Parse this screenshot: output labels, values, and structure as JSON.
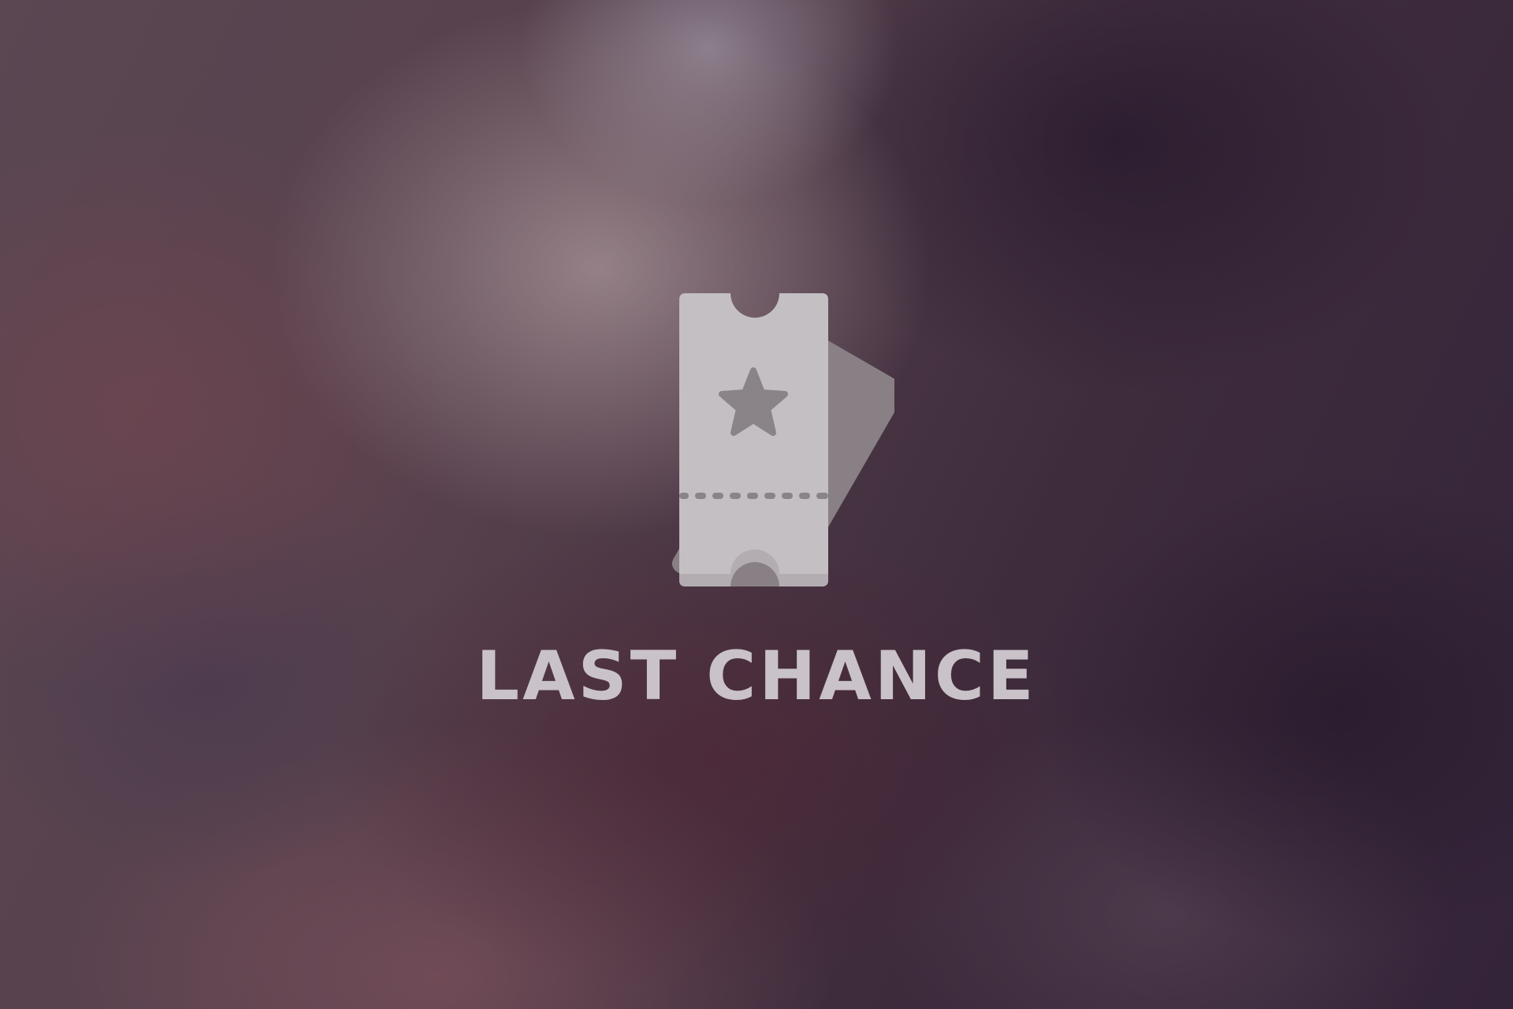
{
  "hero": {
    "icon": "ticket-star-icon",
    "title": "LAST CHANCE"
  },
  "colors": {
    "ticket_front": "#c4bfc3",
    "ticket_back": "#888085",
    "star": "#8a8388",
    "text": "#c9c2c9"
  }
}
